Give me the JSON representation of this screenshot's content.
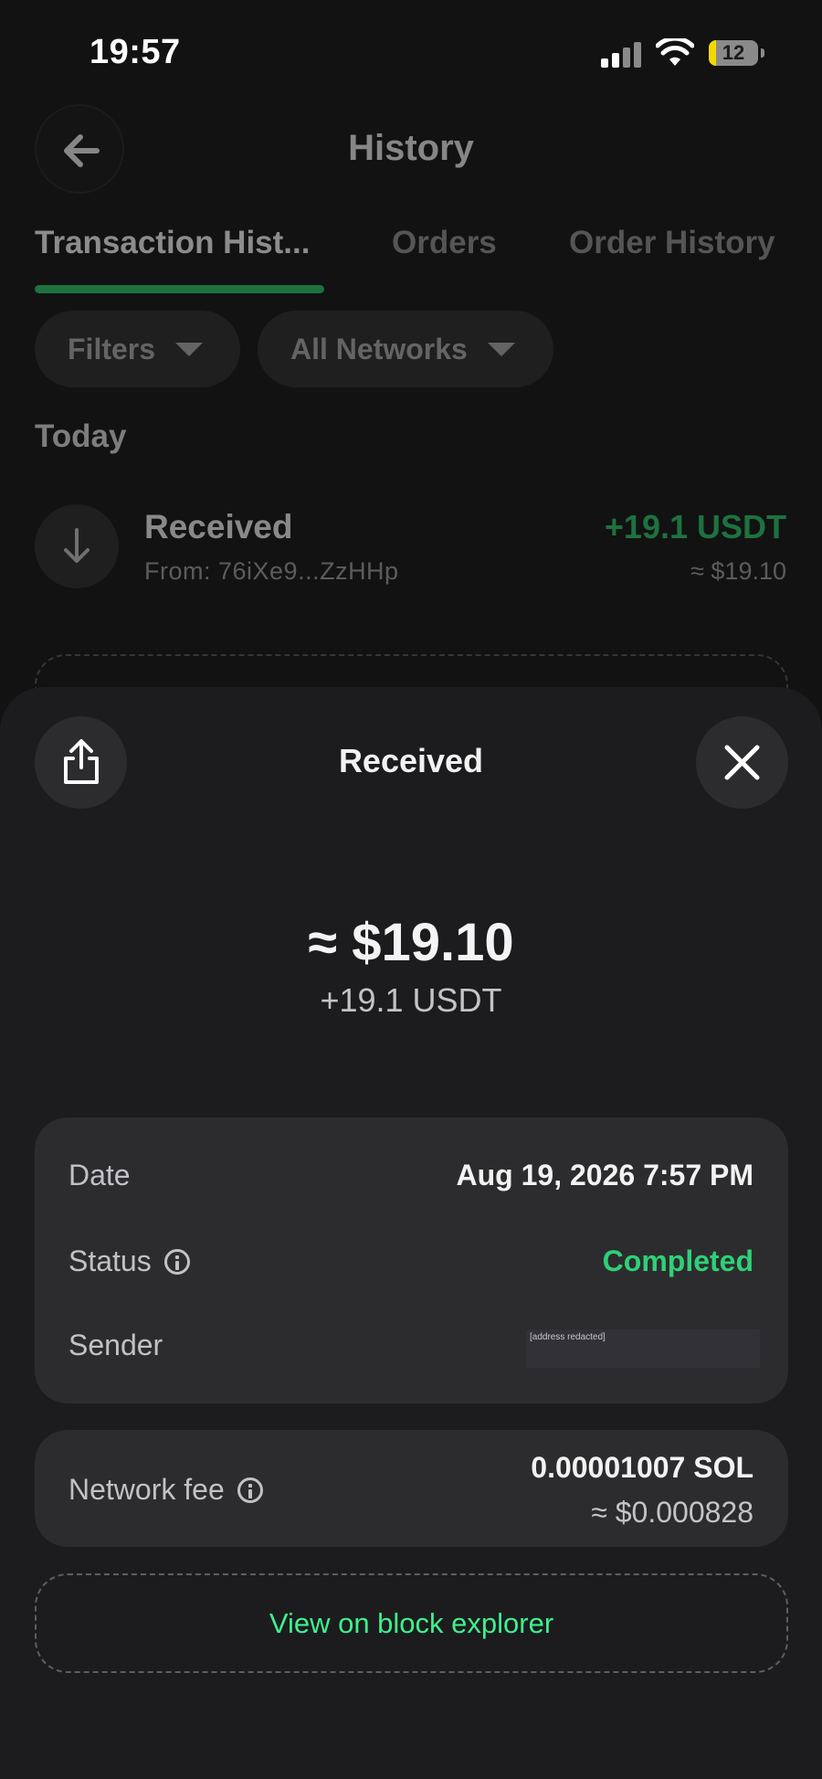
{
  "status_bar": {
    "time": "19:57",
    "battery_level": "12",
    "icons": [
      "cellular-signal-icon",
      "wifi-icon",
      "battery-icon"
    ]
  },
  "header": {
    "title": "History",
    "back_icon": "arrow-left-icon"
  },
  "tabs": [
    {
      "label": "Transaction Hist...",
      "active": true
    },
    {
      "label": "Orders",
      "active": false
    },
    {
      "label": "Order History",
      "active": false
    }
  ],
  "filters": {
    "filter_label": "Filters",
    "network_label": "All Networks"
  },
  "list": {
    "section_label": "Today",
    "items": [
      {
        "title": "Received",
        "subtitle": "From: 76iXe9...ZzHHp",
        "amount": "+19.1 USDT",
        "usd_value": "≈ $19.10",
        "icon": "arrow-down-icon"
      }
    ]
  },
  "sheet": {
    "title": "Received",
    "share_icon": "share-icon",
    "close_icon": "close-icon",
    "usd_amount": "≈ $19.10",
    "token_amount": "+19.1 USDT",
    "details": {
      "date_label": "Date",
      "date_value": "Aug 19, 2026 7:57 PM",
      "status_label": "Status",
      "status_value": "Completed",
      "sender_label": "Sender",
      "sender_value": "[address redacted]"
    },
    "fee": {
      "label": "Network fee",
      "value": "0.00001007 SOL",
      "usd_value": "≈ $0.000828"
    },
    "explorer_label": "View on block explorer"
  },
  "colors": {
    "accent_green": "#27c266",
    "status_green": "#2fd077",
    "link_green": "#3ff08e",
    "background": "#121212",
    "sheet": "#1c1c1e"
  }
}
